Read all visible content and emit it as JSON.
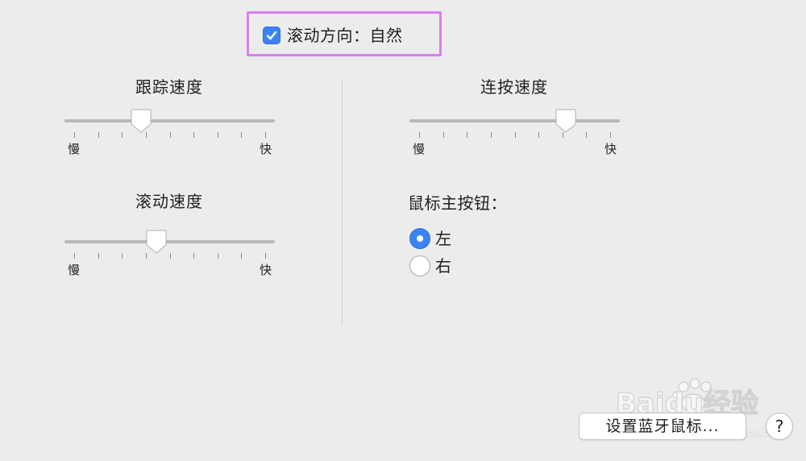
{
  "scroll_direction": {
    "label": "滚动方向：自然",
    "checked": true
  },
  "tracking_speed": {
    "title": "跟踪速度",
    "slow_label": "慢",
    "fast_label": "快",
    "value": 0.35
  },
  "scroll_speed": {
    "title": "滚动速度",
    "slow_label": "慢",
    "fast_label": "快",
    "value": 0.43
  },
  "double_click_speed": {
    "title": "连按速度",
    "slow_label": "慢",
    "fast_label": "快",
    "value": 0.77
  },
  "primary_button": {
    "label": "鼠标主按钮：",
    "options": [
      {
        "label": "左",
        "selected": true
      },
      {
        "label": "右",
        "selected": false
      }
    ]
  },
  "bluetooth_button_label": "设置蓝牙鼠标...",
  "help_label": "?",
  "colors": {
    "accent": "#3b82f6",
    "highlight": "#d97ef2",
    "background": "#ececec"
  },
  "watermark": {
    "text": "Baidu经验",
    "sub": "jingyan.baidu.com"
  }
}
